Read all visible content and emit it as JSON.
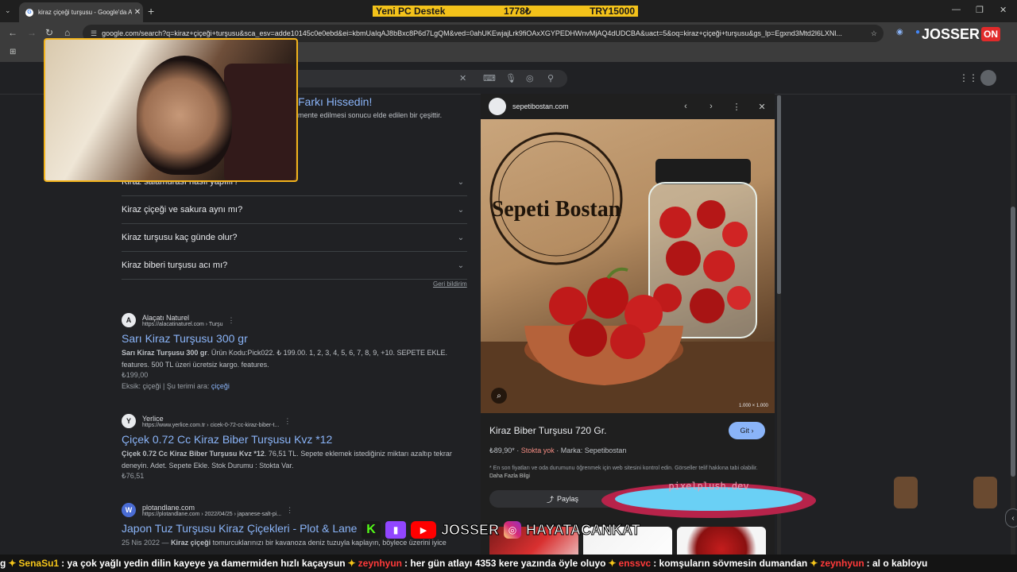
{
  "browser": {
    "tab_title": "kiraz çiçeği turşusu - Google'da Ara",
    "tab_close": "✕",
    "new_tab": "+",
    "url": "google.com/search?q=kiraz+çiçeği+turşusu&sca_esv=adde10145c0e0ebd&ei=kbmUaIqAJ8bBxc8P6d7LgQM&ved=0ahUKEwjajLrk9fiOAxXGYPEDHWnvMjAQ4dUDCBA&uact=5&oq=kiraz+çiçeği+turşusu&gs_lp=Egxnd3Mtd2l6LXNl...",
    "window_min": "—",
    "window_max": "❐",
    "window_close": "✕",
    "accent": "#8ab4f8"
  },
  "promo": {
    "part1": "Yeni PC Destek",
    "part2": "1778₺",
    "part3": "TRY15000"
  },
  "webcam_behind": {
    "title_fragment": "Farkı Hissedin!",
    "snippet_fragment": "mente edilmesi sonucu elde edilen bir çeşittir."
  },
  "faq": [
    {
      "question": "Kiraz salamurası nasıl yapılır?"
    },
    {
      "question": "Kiraz çiçeği ve sakura aynı mı?"
    },
    {
      "question": "Kiraz turşusu kaç günde olur?"
    },
    {
      "question": "Kiraz biberi turşusu acı mı?"
    }
  ],
  "feedback_label": "Geri bildirim",
  "results": [
    {
      "site": "Alaçatı Naturel",
      "url": "https://alacatinaturel.com › Turşu",
      "title": "Sarı Kiraz Turşusu 300 gr",
      "snippet_bold": "Sarı Kiraz Turşusu 300 gr",
      "snippet": ". Ürün Kodu:Pick022. ₺ 199.00. 1, 2, 3, 4, 5, 6, 7, 8, 9, +10. SEPETE EKLE. features. 500 TL üzeri ücretsiz kargo. features.",
      "price": "₺199,00",
      "missing_prefix": "Eksik: çiçeği | Şu terimi ara: ",
      "missing_link": "çiçeği"
    },
    {
      "site": "Yerlice",
      "url": "https://www.yerlice.com.tr › cicek-0-72-cc-kiraz-biber-t...",
      "title": "Çiçek 0.72 Cc Kiraz Biber Turşusu Kvz *12",
      "snippet_bold": "Çiçek 0.72 Cc Kiraz Biber Turşusu Kvz *12",
      "snippet": ". 76,51 TL. Sepete eklemek istediğiniz miktarı azaltıp tekrar deneyin. Adet. Sepete Ekle. Stok Durumu : Stokta Var.",
      "price": "₺76,51"
    },
    {
      "site": "plotandlane.com",
      "url": "https://plotandlane.com › 2022/04/25 › japanese-salt-pi...",
      "title": "Japon Tuz Turşusu Kiraz Çiçekleri - Plot & Lane",
      "snippet_date": "25 Nis 2022 —",
      "snippet_bold": "Kiraz çiçeği",
      "snippet": " tomurcuklarınızı bir kavanoza deniz tuzuyla kaplayın, böylece üzerini iyice"
    }
  ],
  "panel": {
    "source": "sepetibostan.com",
    "image_dims": "1.000 × 1.000",
    "product_title": "Kiraz Biber Turşusu 720 Gr.",
    "go_button": "Git ›",
    "price": "₺89,90*",
    "stock": "Stokta yok",
    "brand": "Marka: Sepetibostan",
    "note": "* En son fiyatları ve oda durumunu öğrenmek için web sitesini kontrol edin. Görseller telif hakkına tabi olabilir.",
    "more_info": "Daha Fazla Bilgi",
    "share": "Paylaş",
    "brand_print": "Sepeti Bostan",
    "out_color": "#f28b82"
  },
  "overlay": {
    "logo_text": "JOSSER",
    "logo_badge": "ON",
    "pixel_label": "pixelplush.dev",
    "social_josser": "JOSSER",
    "social_insta": "HAYATACANKAT",
    "social_k": "K"
  },
  "ticker": {
    "items": [
      {
        "user": "SenaSu1",
        "msg": ": ya çok yağlı yedin dilin kayeye ya damermiden hızlı kaçaysun"
      },
      {
        "user": "zeynhyun",
        "msg": ": her gün atlayı 4353 kere yazında öyle oluyo"
      },
      {
        "user": "enssvc",
        "msg": ": komşuların sövmesin dumandan"
      },
      {
        "user": "zeynhyun",
        "msg": ": al o kabloyu"
      }
    ],
    "lead": "g"
  }
}
